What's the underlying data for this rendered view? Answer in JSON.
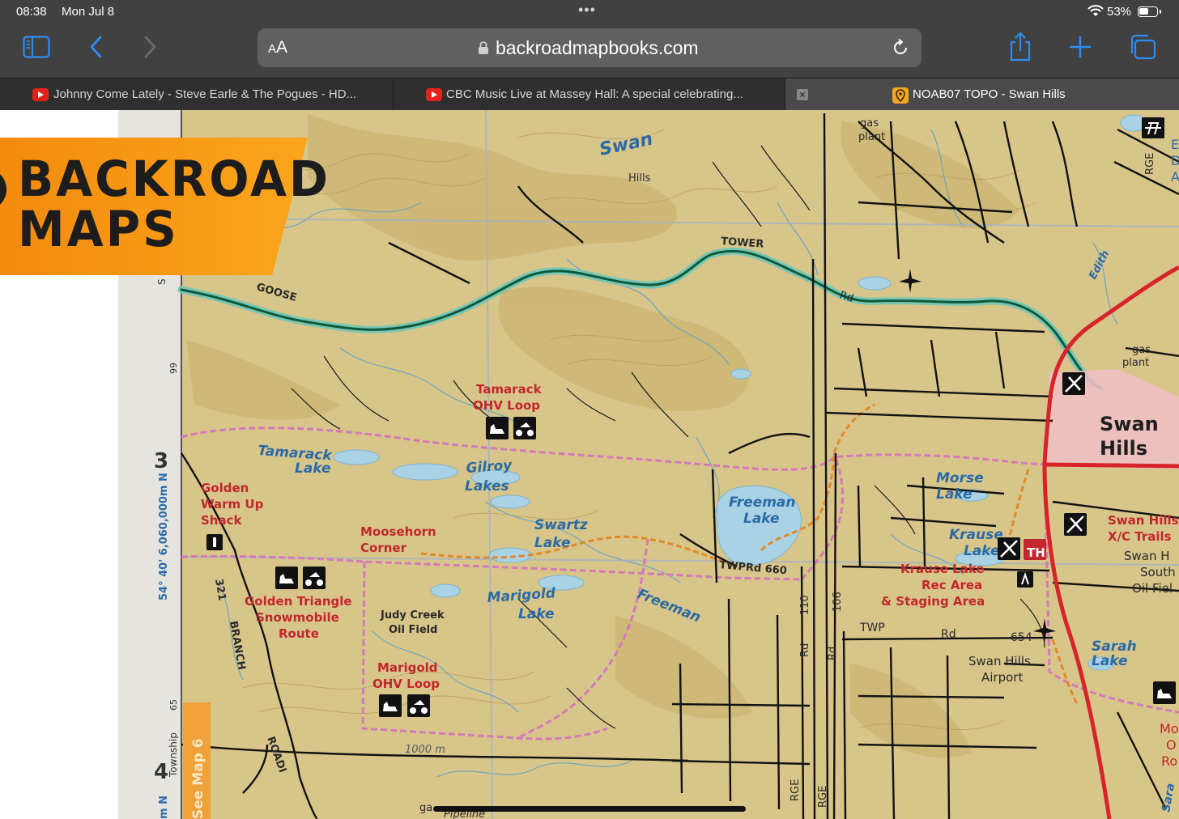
{
  "status_bar": {
    "time": "08:38",
    "date": "Mon Jul 8",
    "battery_percent": "53%",
    "battery_level": 0.53
  },
  "toolbar": {
    "text_size_label": "AA",
    "url": "backroadmapbooks.com",
    "icons": [
      "sidebar-icon",
      "back-icon",
      "forward-icon",
      "lock-icon",
      "reload-icon",
      "share-icon",
      "new-tab-icon",
      "tabs-icon"
    ]
  },
  "tabs": [
    {
      "label": "Johnny Come Lately - Steve Earle & The Pogues - HD...",
      "icon": "youtube-icon"
    },
    {
      "label": "CBC Music Live at Massey Hall: A special celebrating...",
      "icon": "youtube-icon"
    },
    {
      "label": "NOAB07 TOPO - Swan Hills",
      "icon": "map-pin-icon",
      "active": true
    }
  ],
  "logo": {
    "line1": "BACKROAD",
    "line2": "MAPS"
  },
  "map": {
    "colors": {
      "land": "#d8c58a",
      "water": "#a9d2e4",
      "river": "#1e8a7a",
      "highway": "#d6242a",
      "boundary": "#d47ab8",
      "trail": "#e08a2a",
      "town": "#eebfc2"
    },
    "labels": {
      "swan": "Swan",
      "hills_small": "Hills",
      "gas_plant_top": "gas",
      "gas_plant_top2": "plant",
      "tower": "TOWER",
      "goose": "GOOSE",
      "rd_top": "Rd",
      "tamarack_ohv1": "Tamarack",
      "tamarack_ohv2": "OHV Loop",
      "tamarack_lake1": "Tamarack",
      "tamarack_lake2": "Lake",
      "gilroy1": "Gilroy",
      "gilroy2": "Lakes",
      "golden1": "Golden",
      "golden2": "Warm Up",
      "golden3": "Shack",
      "moosehorn1": "Moosehorn",
      "moosehorn2": "Corner",
      "swartz1": "Swartz",
      "swartz2": "Lake",
      "freeman_lake1": "Freeman",
      "freeman_lake2": "Lake",
      "morse1": "Morse",
      "morse2": "Lake",
      "krause1": "Krause",
      "krause2": "Lake",
      "krause_rec1": "Krause Lake",
      "krause_rec2": "Rec Area",
      "krause_rec3": "& Staging Area",
      "twprd_660": "TWPRd 660",
      "golden_tri1": "Golden Triangle",
      "golden_tri2": "Snowmobile",
      "golden_tri3": "Route",
      "judy1": "Judy Creek",
      "judy2": "Oil Field",
      "marigold_lake1": "Marigold",
      "marigold_lake2": "Lake",
      "freeman_road": "Freeman",
      "marigold_ohv1": "Marigold",
      "marigold_ohv2": "OHV Loop",
      "rd_110": "110",
      "rd_106": "106",
      "rd_a": "Rd",
      "rd_b": "Rd",
      "twp": "TWP",
      "rd_c": "Rd",
      "n654": "654",
      "airport1": "Swan Hills",
      "airport2": "Airport",
      "sarah1": "Sarah",
      "sarah2": "Lake",
      "swanhills_town1": "Swan",
      "swanhills_town2": "Hills",
      "xc1": "Swan Hills",
      "xc2": "X/C Trails",
      "oil1": "Swan H",
      "oil2": "South",
      "oil3": "Oil Fiel",
      "gas_plant_right1": "gas",
      "gas_plant_right2": "plant",
      "th_badge": "TH",
      "road_elev": "1000 m",
      "rge_top": "RGE",
      "rge_b1": "RGE",
      "rge_b2": "RGE",
      "branch": "BRANCH",
      "road_321": "321",
      "roadi": "ROADI",
      "pipeline": "Pipeline",
      "edith": "Edith",
      "grid_3": "3",
      "grid_4": "4",
      "coord_lat": "54° 40' 6,060,000m N",
      "coord_99": "99",
      "coord_65": "65",
      "coord_s": "S",
      "coord_n": "m N",
      "township": "Township",
      "see_map": "See Map 6",
      "right_e": "E",
      "right_d": "D",
      "right_a": "A",
      "right_mo": "Mo",
      "right_o": "O",
      "right_ro": "Ro",
      "right_sara": "Sara",
      "gas_left": "ga"
    },
    "icons": [
      "atv-icon",
      "snowmobile-icon",
      "airport-icon",
      "skier-icon",
      "picnic-icon",
      "info-icon",
      "trailhead-icon",
      "cabin-icon"
    ]
  }
}
